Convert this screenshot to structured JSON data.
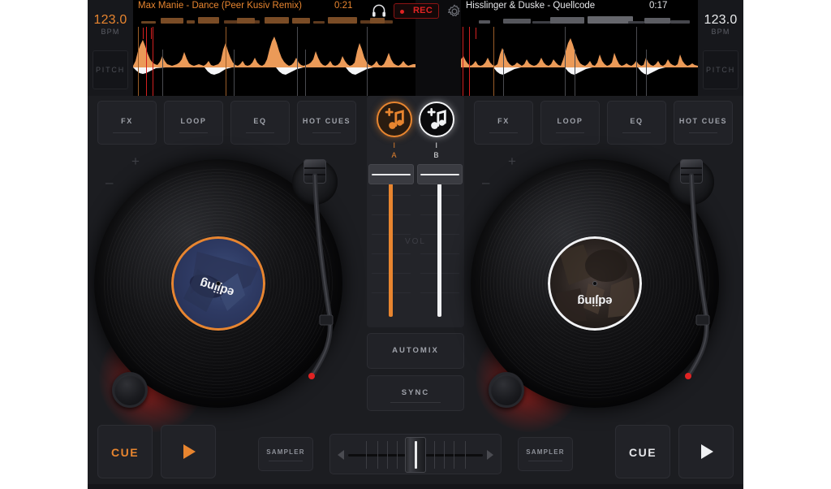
{
  "app": {
    "name": "edjing",
    "brand_orange": "#e8852f",
    "brand_white": "#f0f1f3",
    "rec_red": "#e02323"
  },
  "decks": {
    "a": {
      "track_title": "Max Manie - Dance (Peer Kusiv Remix)",
      "time": "0:21",
      "bpm": "123.0",
      "bpm_label": "BPM",
      "pitch_label": "PITCH",
      "vinyl_word": "edjing",
      "deck_letter": "A",
      "deck_mark": "I",
      "cue_label": "CUE",
      "play_icon": "play-triangle-icon",
      "sampler_label": "SAMPLER",
      "plus": "+",
      "minus": "–",
      "buttons": [
        {
          "label": "FX"
        },
        {
          "label": "LOOP"
        },
        {
          "label": "EQ"
        },
        {
          "label": "HOT CUES"
        }
      ]
    },
    "b": {
      "track_title": "Hisslinger & Duske - Quellcode",
      "time": "0:17",
      "bpm": "123.0",
      "bpm_label": "BPM",
      "pitch_label": "PITCH",
      "vinyl_word": "edjing",
      "deck_letter": "B",
      "deck_mark": "I",
      "cue_label": "CUE",
      "play_icon": "play-triangle-icon",
      "sampler_label": "SAMPLER",
      "plus": "+",
      "minus": "–",
      "buttons": [
        {
          "label": "FX"
        },
        {
          "label": "LOOP"
        },
        {
          "label": "EQ"
        },
        {
          "label": "HOT CUES"
        }
      ]
    }
  },
  "header": {
    "headphone_icon": "headphones-icon",
    "record_label": "REC",
    "record_dot": "•",
    "settings_icon": "gear-icon"
  },
  "mixer": {
    "vol_label": "VOL",
    "automix_label": "AUTOMIX",
    "sync_label": "SYNC",
    "deck_a_icon": "music-note-plus-icon",
    "deck_b_icon": "music-note-plus-icon",
    "fader_a_position_pct": 100,
    "fader_b_position_pct": 100
  },
  "crossfader": {
    "position_pct": 50,
    "left_arrow_icon": "arrow-left-icon",
    "right_arrow_icon": "arrow-right-icon"
  }
}
